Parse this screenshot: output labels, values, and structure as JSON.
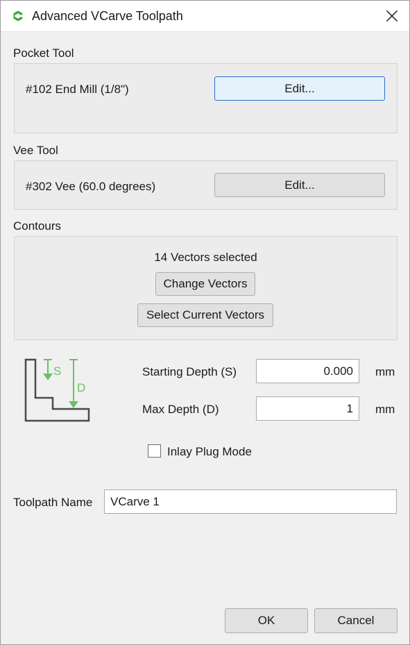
{
  "window": {
    "title": "Advanced VCarve Toolpath"
  },
  "pocket_tool": {
    "section_label": "Pocket Tool",
    "tool_name": "#102 End Mill (1/8\")",
    "edit_label": "Edit..."
  },
  "vee_tool": {
    "section_label": "Vee Tool",
    "tool_name": "#302 Vee (60.0 degrees)",
    "edit_label": "Edit..."
  },
  "contours": {
    "section_label": "Contours",
    "selection_status": "14 Vectors selected",
    "change_vectors_label": "Change Vectors",
    "select_current_label": "Select Current Vectors"
  },
  "depth_diagram": {
    "s_label": "S",
    "d_label": "D"
  },
  "depth": {
    "starting_label": "Starting Depth (S)",
    "starting_value": "0.000",
    "starting_unit": "mm",
    "max_label": "Max Depth (D)",
    "max_value": "1",
    "max_unit": "mm"
  },
  "inlay": {
    "label": "Inlay Plug Mode",
    "checked": false
  },
  "toolpath_name": {
    "label": "Toolpath Name",
    "value": "VCarve 1"
  },
  "footer": {
    "ok_label": "OK",
    "cancel_label": "Cancel"
  },
  "colors": {
    "diagram_green": "#6abf69",
    "focus_blue": "#2c6fce",
    "app_icon_green": "#3fa535"
  }
}
